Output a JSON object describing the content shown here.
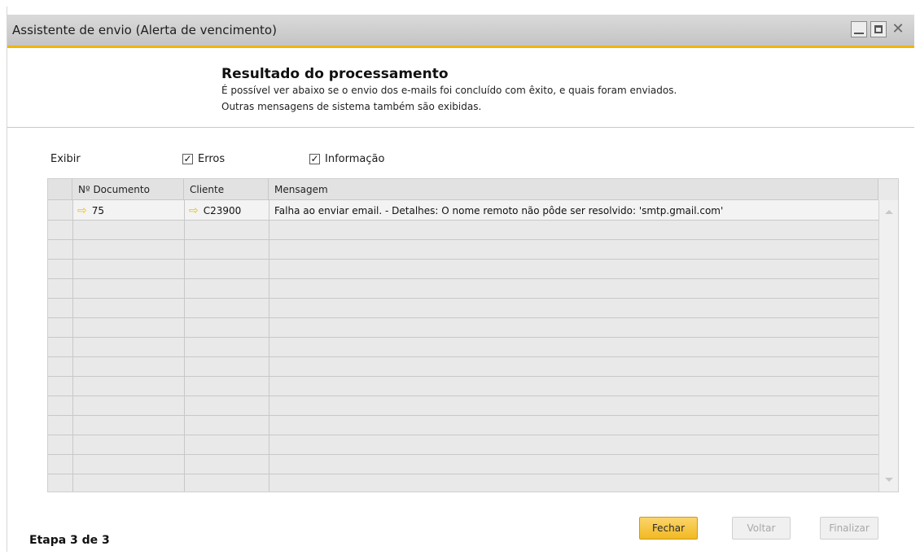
{
  "window": {
    "title": "Assistente de envio (Alerta de vencimento)",
    "close_glyph": "✕",
    "accent_color": "#f0b400"
  },
  "header": {
    "title": "Resultado do processamento",
    "line1": "É possível ver abaixo se o envio dos e-mails foi concluído com êxito, e quais foram enviados.",
    "line2": "Outras mensagens de sistema também são exibidas."
  },
  "filters": {
    "show_label": "Exibir",
    "errors_label": "Erros",
    "errors_checked": true,
    "info_label": "Informação",
    "info_checked": true,
    "check_glyph": "✓"
  },
  "table": {
    "columns": [
      "Nº Documento",
      "Cliente",
      "Mensagem"
    ],
    "rows": [
      {
        "document": "75",
        "client": "C23900",
        "message": "Falha ao enviar email. - Detalhes: O nome remoto não pôde ser resolvido: 'smtp.gmail.com'",
        "link_icon": "link-arrow-icon"
      }
    ]
  },
  "footer": {
    "step": "Etapa 3 de 3",
    "buttons": {
      "close": "Fechar",
      "back": "Voltar",
      "finish": "Finalizar"
    }
  }
}
